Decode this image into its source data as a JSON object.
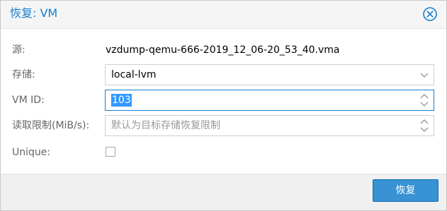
{
  "dialog": {
    "title": "恢复: VM",
    "close_icon": "close-circle-icon"
  },
  "form": {
    "source": {
      "label": "源:",
      "value": "vzdump-qemu-666-2019_12_06-20_53_40.vma"
    },
    "storage": {
      "label": "存储:",
      "value": "local-lvm",
      "trigger_icon": "chevron-down-icon"
    },
    "vmid": {
      "label": "VM ID:",
      "value": "103",
      "trigger_icon": "spinner-icon"
    },
    "read_limit": {
      "label": "读取限制(MiB/s):",
      "placeholder": "默认为目标存储恢复限制",
      "trigger_icon": "spinner-icon"
    },
    "unique": {
      "label": "Unique:",
      "checked": false
    }
  },
  "footer": {
    "restore_label": "恢复"
  },
  "colors": {
    "accent": "#157fcc",
    "button_bg": "#3892d4",
    "selection": "#3399ff"
  }
}
